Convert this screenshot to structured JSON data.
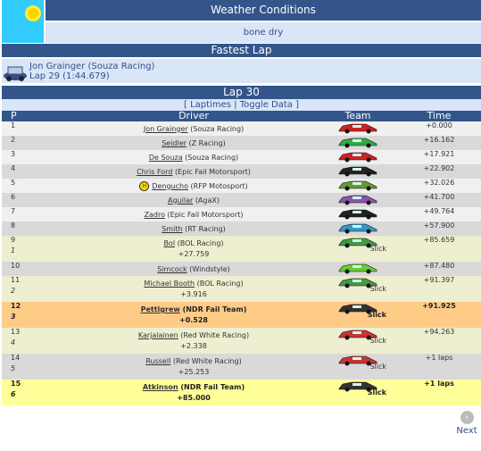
{
  "weather": {
    "title": "Weather Conditions",
    "condition": "bone dry"
  },
  "fastest_lap": {
    "title": "Fastest Lap",
    "driver": "Jon Grainger (Souza Racing)",
    "lap": "Lap 29 (1:44.679)"
  },
  "lap": {
    "title": "Lap 30"
  },
  "links": {
    "laptimes": "Laptimes",
    "toggle": "Toggle Data"
  },
  "table": {
    "headers": {
      "pos": "P",
      "driver": "Driver",
      "team": "Team",
      "time": "Time"
    },
    "rows": [
      {
        "pos": "1",
        "name": "Jon Grainger",
        "team": "(Souza Racing)",
        "time": "+0.000",
        "car": "#cc2222"
      },
      {
        "pos": "2",
        "name": "Seidler",
        "team": "(Z Racing)",
        "time": "+16.162",
        "car": "#33aa44"
      },
      {
        "pos": "3",
        "name": "De Souza",
        "team": "(Souza Racing)",
        "time": "+17.921",
        "car": "#cc2222"
      },
      {
        "pos": "4",
        "name": "Chris Ford",
        "team": "(Epic Fail Motorsport)",
        "time": "+22.902",
        "car": "#222222"
      },
      {
        "pos": "5",
        "name": "Dengucho",
        "team": "(RFP Motosport)",
        "time": "+32.026",
        "car": "#669933",
        "badge": "H"
      },
      {
        "pos": "6",
        "name": "Aguilar",
        "team": "(AgaX)",
        "time": "+41.700",
        "car": "#8855aa"
      },
      {
        "pos": "7",
        "name": "Zadro",
        "team": "(Epic Fail Motorsport)",
        "time": "+49.764",
        "car": "#222222"
      },
      {
        "pos": "8",
        "name": "Smith",
        "team": "(RT Racing)",
        "time": "+57.900",
        "car": "#3399cc"
      },
      {
        "pos": "9",
        "name": "Bol",
        "team": "(BOL Racing)",
        "time": "+85.659",
        "car": "#449944",
        "sub": "1",
        "gap": "+27.759",
        "tyre": "Slick"
      },
      {
        "pos": "10",
        "name": "Simcock",
        "team": "(Windstyle)",
        "time": "+87.480",
        "car": "#66cc33"
      },
      {
        "pos": "11",
        "name": "Michael Booth",
        "team": "(BOL Racing)",
        "time": "+91.397",
        "car": "#449944",
        "sub": "2",
        "gap": "+3.916",
        "tyre": "Slick"
      },
      {
        "pos": "12",
        "name": "Pettigrew",
        "team": "(NDR Fail Team)",
        "time": "+91.925",
        "car": "#333333",
        "sub": "3",
        "gap": "+0.528",
        "tyre": "Slick"
      },
      {
        "pos": "13",
        "name": "Karjalainen",
        "team": "(Red White Racing)",
        "time": "+94.263",
        "car": "#cc3333",
        "sub": "4",
        "gap": "+2.338",
        "tyre": "Slick"
      },
      {
        "pos": "14",
        "name": "Russell",
        "team": "(Red White Racing)",
        "time": "+1 laps",
        "car": "#cc3333",
        "sub": "5",
        "gap": "+25.253",
        "tyre": "Slick"
      },
      {
        "pos": "15",
        "name": "Atkinson",
        "team": "(NDR Fail Team)",
        "time": "+1 laps",
        "car": "#333333",
        "sub": "6",
        "gap": "+85.000",
        "tyre": "Slick"
      }
    ]
  },
  "nav": {
    "next": "Next"
  }
}
